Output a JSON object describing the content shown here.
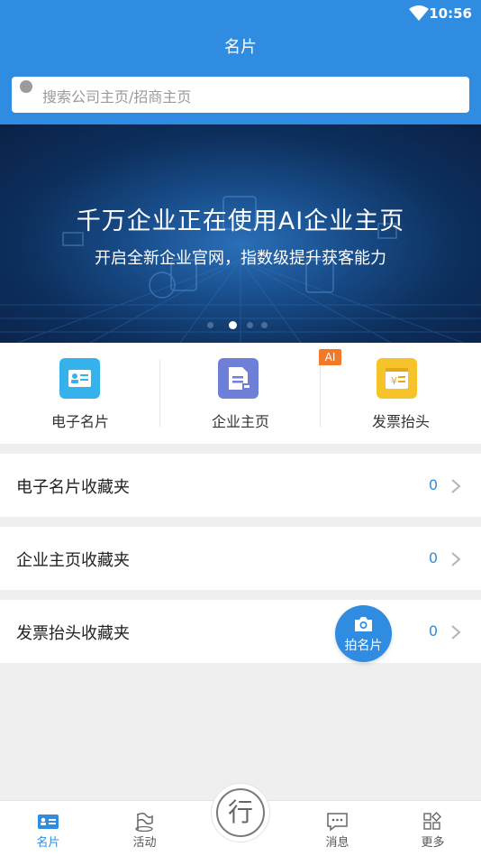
{
  "status_bar": {
    "time": "10:56"
  },
  "header": {
    "title": "名片"
  },
  "search": {
    "placeholder": "搜索公司主页/招商主页"
  },
  "banner": {
    "headline": "千万企业正在使用AI企业主页",
    "subline": "开启全新企业官网，指数级提升获客能力",
    "dot_count": 4,
    "active_dot": 1
  },
  "shortcuts": [
    {
      "label": "电子名片",
      "color": "#35b2ec",
      "icon": "id-card-icon"
    },
    {
      "label": "企业主页",
      "color": "#6d7fd6",
      "icon": "document-icon"
    },
    {
      "label": "发票抬头",
      "color": "#f7c32b",
      "icon": "invoice-icon",
      "badge": "AI"
    }
  ],
  "folders": [
    {
      "label": "电子名片收藏夹",
      "count": "0"
    },
    {
      "label": "企业主页收藏夹",
      "count": "0"
    },
    {
      "label": "发票抬头收藏夹",
      "count": "0"
    }
  ],
  "fab": {
    "label": "拍名片",
    "icon": "camera-icon"
  },
  "tabs": [
    {
      "label": "名片",
      "icon": "card-icon",
      "active": true
    },
    {
      "label": "活动",
      "icon": "flag-icon",
      "active": false
    },
    {
      "label": "行",
      "icon": "center-action-icon",
      "active": false
    },
    {
      "label": "消息",
      "icon": "message-icon",
      "active": false
    },
    {
      "label": "更多",
      "icon": "apps-icon",
      "active": false
    }
  ],
  "colors": {
    "primary": "#2f8ce0",
    "badge": "#f07a2a",
    "background": "#efefef"
  }
}
